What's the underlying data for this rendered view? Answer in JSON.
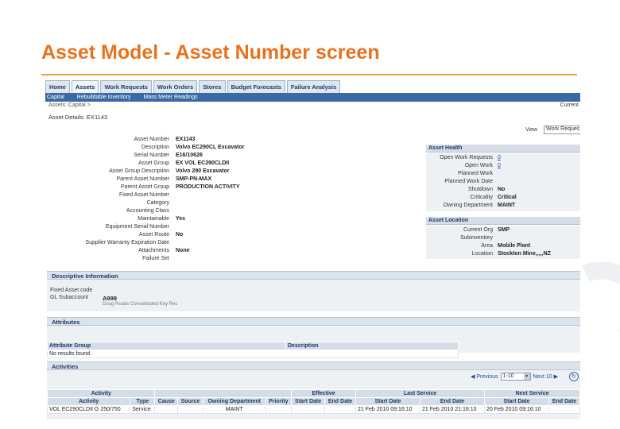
{
  "slide": {
    "title": "Asset Model - Asset Number screen"
  },
  "tabs": [
    {
      "label": "Home"
    },
    {
      "label": "Assets"
    },
    {
      "label": "Work Requests"
    },
    {
      "label": "Work Orders"
    },
    {
      "label": "Stores"
    },
    {
      "label": "Budget Forecasts"
    },
    {
      "label": "Failure Analysis"
    }
  ],
  "subtabs": [
    {
      "label": "Capital"
    },
    {
      "label": "Rebuildable Inventory"
    },
    {
      "label": "Mass Meter Readings"
    }
  ],
  "breadcrumb": "Assets: Capital  >",
  "current_label": "Current",
  "page_title": "Asset Details: EX1143",
  "view": {
    "label": "View",
    "value": "Work Reques"
  },
  "details": [
    {
      "label": "Asset Number",
      "value": "EX1143"
    },
    {
      "label": "Description",
      "value": "Volvo EC290CL Excavator"
    },
    {
      "label": "Serial Number",
      "value": "E16/10626"
    },
    {
      "label": "Asset Group",
      "value": "EX VOL EC290CLDII"
    },
    {
      "label": "Asset Group Description",
      "value": "Volvo 290 Excavator"
    },
    {
      "label": "Parent Asset Number",
      "value": "SMP-PN-MAX"
    },
    {
      "label": "Parent Asset Group",
      "value": "PRODUCTION ACTIVITY"
    },
    {
      "label": "Fixed Asset Number",
      "value": ""
    },
    {
      "label": "Category",
      "value": ""
    },
    {
      "label": "Accounting Class",
      "value": ""
    },
    {
      "label": "Maintainable",
      "value": "Yes"
    },
    {
      "label": "Equipment Serial Number",
      "value": ""
    },
    {
      "label": "Asset Route",
      "value": "No"
    },
    {
      "label": "Supplier Warranty Expiration Date",
      "value": ""
    },
    {
      "label": "Attachments",
      "value": "None"
    },
    {
      "label": "Failure Set",
      "value": ""
    }
  ],
  "asset_health": {
    "title": "Asset Health",
    "rows": [
      {
        "label": "Open Work Requests",
        "value": "0"
      },
      {
        "label": "Open Work",
        "value": "0"
      },
      {
        "label": "Planned Work",
        "value": ""
      },
      {
        "label": "Planned Work Date",
        "value": ""
      },
      {
        "label": "Shutdown",
        "value": "No"
      },
      {
        "label": "Criticality",
        "value": "Critical"
      },
      {
        "label": "Owning Department",
        "value": "MAINT"
      }
    ]
  },
  "asset_location": {
    "title": "Asset Location",
    "rows": [
      {
        "label": "Current Org",
        "value": "SMP"
      },
      {
        "label": "Subinventory",
        "value": ""
      },
      {
        "label": "Area",
        "value": "Mobile Plant"
      },
      {
        "label": "Location",
        "value": "Stockton Mine,,,,,NZ"
      }
    ]
  },
  "descriptive": {
    "title": "Descriptive Information",
    "fixed_asset_code_label": "Fixed Asset code",
    "gl_subaccount_label": "GL Subaccount",
    "gl_subaccount_value": "A999",
    "gl_subaccount_desc": "Doug Roads Consolidated Key Rec"
  },
  "attributes": {
    "title": "Attributes",
    "headers": [
      "Attribute Group",
      "Description"
    ],
    "empty_text": "No results found."
  },
  "activities": {
    "title": "Activities",
    "pager": {
      "previous": "Previous",
      "range": "1-10",
      "next": "Next 10"
    },
    "group_headers": [
      "Activity",
      "Effective",
      "Last Service",
      "Next Service"
    ],
    "headers": [
      "Activity",
      "Type",
      "Cause",
      "Source",
      "Owning Department",
      "Priority",
      "Start Date",
      "End Date",
      "Start Date",
      "End Date",
      "Start Date",
      "End Date"
    ],
    "rows": [
      [
        "VOL EC290CLDII G 250/750",
        "Service",
        "",
        "",
        "MAINT",
        "",
        "",
        "",
        "21 Feb 2010 09:16:10",
        "21 Feb 2010 21:16:10",
        "20 Feb 2010 09:16:10",
        ""
      ]
    ]
  }
}
